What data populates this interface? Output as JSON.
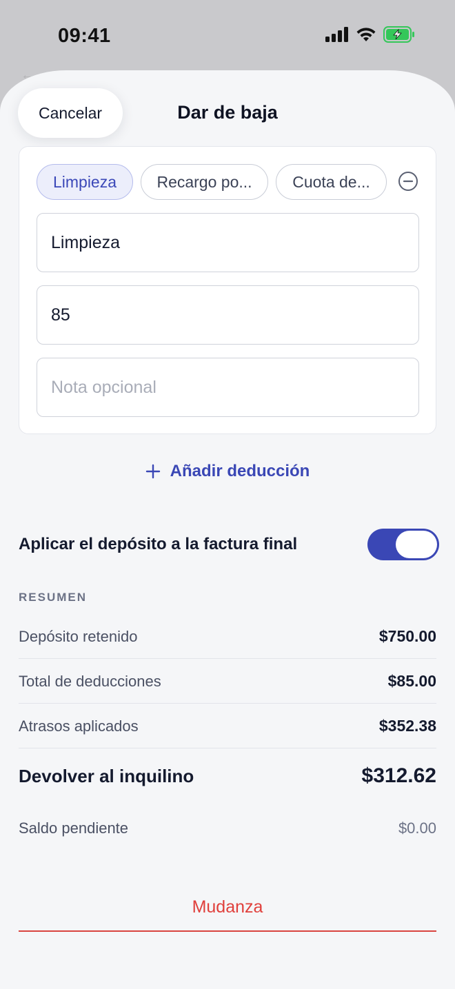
{
  "status_bar": {
    "time": "09:41",
    "icons": [
      "cellular-signal-icon",
      "wifi-icon",
      "battery-charging-icon"
    ],
    "battery_color": "#34c759"
  },
  "background_hint": "← ",
  "sheet": {
    "cancel_label": "Cancelar",
    "title": "Dar de baja"
  },
  "deduction_card": {
    "chips": [
      {
        "label": "Limpieza",
        "selected": true
      },
      {
        "label": "Recargo po...",
        "selected": false
      },
      {
        "label": "Cuota de...",
        "selected": false
      }
    ],
    "remove_icon": "minus-circle-icon",
    "name_value": "Limpieza",
    "amount_value": "85",
    "note_placeholder": "Nota opcional"
  },
  "add_deduction": {
    "icon": "plus-icon",
    "label": "Añadir deducción"
  },
  "apply_deposit": {
    "label": "Aplicar el depósito a la factura final",
    "enabled": true
  },
  "summary": {
    "heading": "RESUMEN",
    "rows": [
      {
        "label": "Depósito retenido",
        "value": "$750.00"
      },
      {
        "label": "Total de deducciones",
        "value": "$85.00"
      },
      {
        "label": "Atrasos aplicados",
        "value": "$352.38"
      }
    ],
    "total": {
      "label": "Devolver al inquilino",
      "value": "$312.62"
    },
    "pending": {
      "label": "Saldo pendiente",
      "value": "$0.00"
    }
  },
  "primary_action": {
    "label": "Mudanza"
  },
  "colors": {
    "accent": "#3a47b5",
    "destructive": "#e0403c",
    "sheet_background": "#f5f6f8"
  }
}
